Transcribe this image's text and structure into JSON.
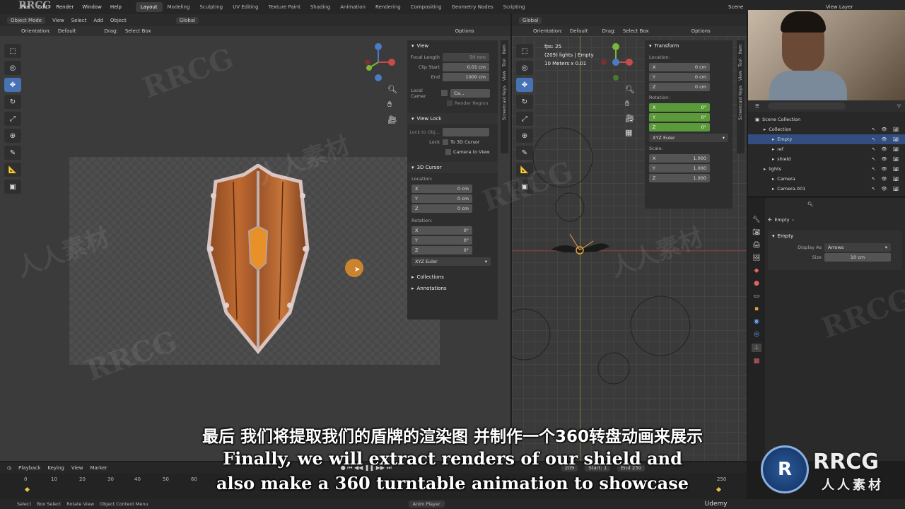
{
  "topbar": {
    "logo": "RRCG",
    "menus": [
      "File",
      "Edit",
      "Render",
      "Window",
      "Help"
    ],
    "workspaces": [
      "Layout",
      "Modeling",
      "Sculpting",
      "UV Editing",
      "Texture Paint",
      "Shading",
      "Animation",
      "Rendering",
      "Compositing",
      "Geometry Nodes",
      "Scripting"
    ],
    "active_workspace": "Layout",
    "scene": "Scene",
    "view_layer": "View Layer"
  },
  "left_viewport": {
    "mode": "Object Mode",
    "menus": [
      "View",
      "Select",
      "Add",
      "Object"
    ],
    "transform": "Global",
    "orientation_label": "Orientation:",
    "orientation": "Default",
    "drag_label": "Drag:",
    "drag": "Select Box",
    "options": "Options",
    "npanel": {
      "view_title": "View",
      "focal_length_label": "Focal Length",
      "focal_length": "50 mm",
      "clip_start_label": "Clip Start",
      "clip_start": "0.01 cm",
      "end_label": "End",
      "end": "1000 cm",
      "local_camera_label": "Local Camer",
      "local_camera_value": "Ca...",
      "render_region": "Render Region",
      "view_lock_title": "View Lock",
      "lock_to_obj_label": "Lock to Obj...",
      "lock_label": "Lock",
      "to_3d_cursor": "To 3D Cursor",
      "camera_to_view": "Camera to View",
      "cursor_title": "3D Cursor",
      "location_label": "Location:",
      "loc": [
        {
          "axis": "X",
          "value": "0 cm"
        },
        {
          "axis": "Y",
          "value": "0 cm"
        },
        {
          "axis": "Z",
          "value": "0 cm"
        }
      ],
      "rotation_label": "Rotation:",
      "rot": [
        {
          "axis": "X",
          "value": "0°"
        },
        {
          "axis": "Y",
          "value": "0°"
        },
        {
          "axis": "Z",
          "value": "0°"
        }
      ],
      "rotation_mode": "XYZ Euler",
      "collections": "Collections",
      "annotations": "Annotations",
      "tabs": [
        "Item",
        "Tool",
        "View",
        "Screencast Keys"
      ]
    }
  },
  "right_viewport": {
    "transform": "Global",
    "orientation_label": "Orientation:",
    "orientation": "Default",
    "drag_label": "Drag:",
    "drag": "Select Box",
    "options": "Options",
    "overlay_fps": "fps: 25",
    "overlay_obj": "(209) lights | Empty",
    "overlay_scale": "10 Meters x 0.01",
    "npanel": {
      "transform_title": "Transform",
      "location_label": "Location:",
      "loc": [
        {
          "axis": "X",
          "value": "0 cm"
        },
        {
          "axis": "Y",
          "value": "0 cm"
        },
        {
          "axis": "Z",
          "value": "0 cm"
        }
      ],
      "rotation_label": "Rotation:",
      "rot": [
        {
          "axis": "X",
          "value": "0°"
        },
        {
          "axis": "Y",
          "value": "0°"
        },
        {
          "axis": "Z",
          "value": "0°"
        }
      ],
      "rotation_mode": "XYZ Euler",
      "scale_label": "Scale:",
      "scale": [
        {
          "axis": "X",
          "value": "1.000"
        },
        {
          "axis": "Y",
          "value": "1.000"
        },
        {
          "axis": "Z",
          "value": "1.000"
        }
      ],
      "tabs": [
        "Item",
        "Tool",
        "View",
        "Screencast Keys"
      ]
    }
  },
  "outliner": {
    "root": "Scene Collection",
    "items": [
      {
        "name": "Collection",
        "indent": 1
      },
      {
        "name": "Empty",
        "indent": 2,
        "selected": true
      },
      {
        "name": "ref",
        "indent": 2
      },
      {
        "name": "shield",
        "indent": 2
      },
      {
        "name": "lights",
        "indent": 1
      },
      {
        "name": "Camera",
        "indent": 2
      },
      {
        "name": "Camera.001",
        "indent": 2
      }
    ]
  },
  "properties": {
    "object_name": "Empty",
    "section": "Empty",
    "display_as_label": "Display As",
    "display_as": "Arrows",
    "size_label": "Size",
    "size": "10 cm"
  },
  "timeline": {
    "menus": [
      "Playback",
      "Keying",
      "View",
      "Marker"
    ],
    "current_frame": "209",
    "start_label": "Start",
    "start": "1",
    "end_label": "End",
    "end": "250",
    "ticks": [
      "0",
      "10",
      "20",
      "30",
      "40",
      "50",
      "60",
      "250"
    ]
  },
  "statusbar": {
    "items": [
      "Select",
      "Box Select",
      "Rotate View",
      "Object Context Menu"
    ],
    "anim_player": "Anim Player",
    "udemy": "Udemy"
  },
  "subtitles": {
    "zh": "最后 我们将提取我们的盾牌的渲染图 并制作一个360转盘动画来展示",
    "en_line1": "Finally, we will extract renders of our shield and",
    "en_line2": "also make a 360 turntable animation to showcase"
  },
  "brand": {
    "big": "RRCG",
    "small": "人人素材"
  },
  "colors": {
    "accent": "#4772b3",
    "green_field": "#5a9a3a",
    "orange_cursor": "#d98a2b"
  }
}
